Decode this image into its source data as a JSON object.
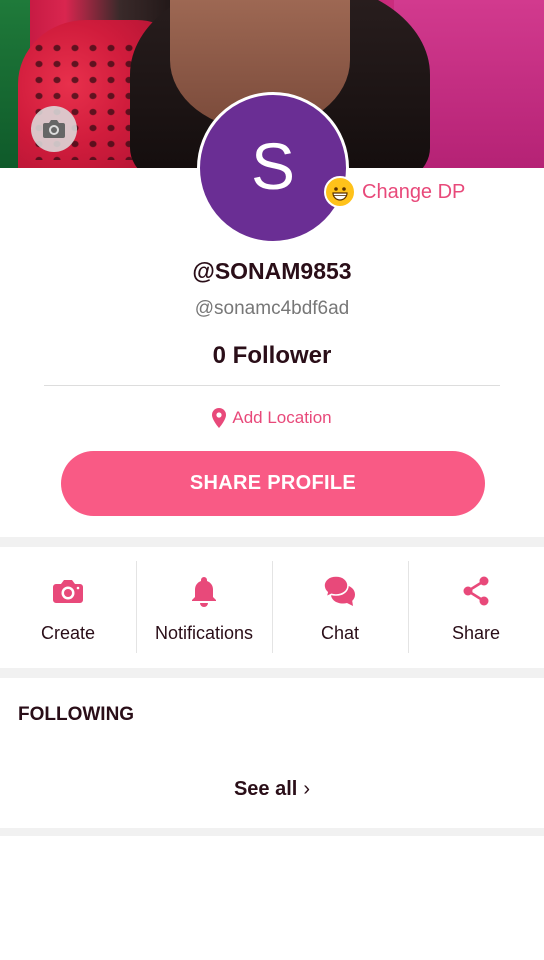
{
  "colors": {
    "accent": "#f95a85",
    "accent_text": "#e8497a",
    "avatar_bg": "#6a2e94",
    "text_dark": "#2a0e18"
  },
  "cover": {
    "camera_icon": "camera-icon"
  },
  "profile": {
    "avatar_initial": "S",
    "change_dp_label": "Change DP",
    "change_dp_icon": "grinning-emoji-icon",
    "username": "@SONAM9853",
    "handle": "@sonamc4bdf6ad",
    "followers": "0 Follower",
    "location_label": "Add Location",
    "location_icon": "location-pin-icon",
    "share_profile_label": "SHARE PROFILE"
  },
  "actions": [
    {
      "label": "Create",
      "icon": "camera-icon"
    },
    {
      "label": "Notifications",
      "icon": "bell-icon"
    },
    {
      "label": "Chat",
      "icon": "chat-bubbles-icon"
    },
    {
      "label": "Share",
      "icon": "share-icon"
    }
  ],
  "following": {
    "title": "FOLLOWING",
    "see_all_label": "See all",
    "see_all_icon": "chevron-right-icon"
  }
}
